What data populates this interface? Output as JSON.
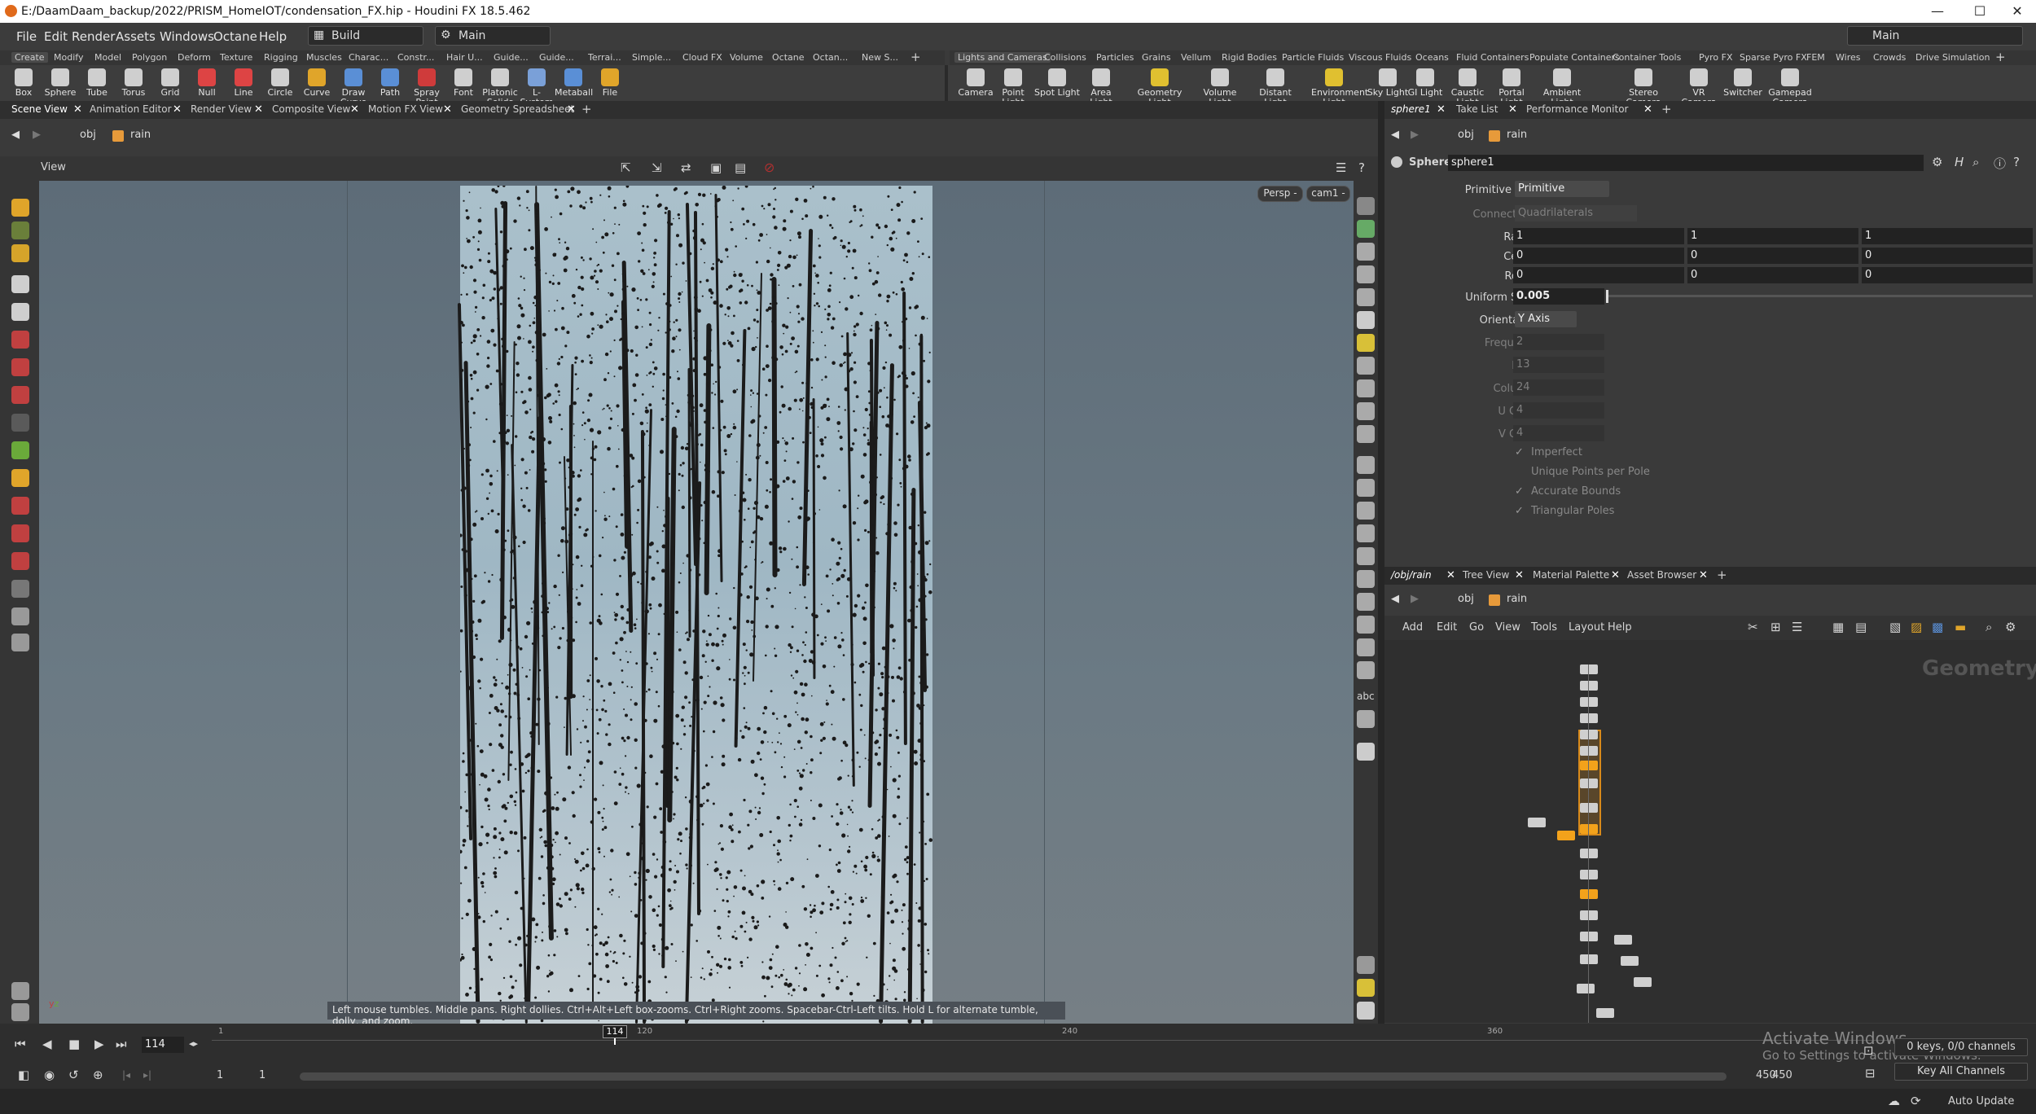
{
  "window": {
    "title": "E:/DaamDaam_backup/2022/PRISM_HomeIOT/condensation_FX.hip - Houdini FX 18.5.462",
    "min": "—",
    "max": "☐",
    "close": "✕"
  },
  "menu": {
    "items": [
      "File",
      "Edit",
      "Render",
      "Assets",
      "Windows",
      "Octane",
      "Help"
    ],
    "desktop": "Build",
    "context": "Main",
    "right_desktop": "Main"
  },
  "shelf_tabs_left": [
    "Create",
    "Modify",
    "Model",
    "Polygon",
    "Deform",
    "Texture",
    "Rigging",
    "Muscles",
    "Charac...",
    "Constr...",
    "Hair U...",
    "Guide...",
    "Guide...",
    "Terrai...",
    "Simple...",
    "Cloud FX",
    "Volume",
    "Octane",
    "Octan...",
    "New S..."
  ],
  "shelf_tabs_right": [
    "Lights and Cameras",
    "Collisions",
    "Particles",
    "Grains",
    "Vellum",
    "Rigid Bodies",
    "Particle Fluids",
    "Viscous Fluids",
    "Oceans",
    "Fluid Containers",
    "Populate Containers",
    "Container Tools",
    "Pyro FX",
    "Sparse Pyro FX",
    "FEM",
    "Wires",
    "Crowds",
    "Drive Simulation"
  ],
  "tools_left": [
    "Box",
    "Sphere",
    "Tube",
    "Torus",
    "Grid",
    "Null",
    "Line",
    "Circle",
    "Curve",
    "Draw Curve",
    "Path",
    "Spray Paint",
    "Font",
    "Platonic Solids",
    "L-System",
    "Metaball",
    "File"
  ],
  "tools_right": [
    "Camera",
    "Point Light",
    "Spot Light",
    "Area Light",
    "Geometry Light",
    "Volume Light",
    "Distant Light",
    "Environment Light",
    "Sky Light",
    "GI Light",
    "Caustic Light",
    "Portal Light",
    "Ambient Light",
    "Stereo Camera",
    "VR Camera",
    "Switcher",
    "Gamepad Camera"
  ],
  "left_pane_tabs": [
    "Scene View",
    "Animation Editor",
    "Render View",
    "Composite View",
    "Motion FX View",
    "Geometry Spreadsheet"
  ],
  "path": {
    "root": "obj",
    "node": "rain"
  },
  "viewport": {
    "label": "View",
    "persp": "Persp -",
    "cam": "cam1 -",
    "hint": "Left mouse tumbles. Middle pans. Right dollies. Ctrl+Alt+Left box-zooms. Ctrl+Right zooms. Spacebar-Ctrl-Left tilts. Hold L for alternate tumble, dolly, and zoom."
  },
  "params_tabs": [
    "sphere1",
    "Take List",
    "Performance Monitor"
  ],
  "params": {
    "node_type": "Sphere",
    "node_name": "sphere1",
    "primitive_type_label": "Primitive Type",
    "primitive_type": "Primitive",
    "connectivity_label": "Connectivity",
    "connectivity": "Quadrilaterals",
    "radius_label": "Radius",
    "radius": [
      "1",
      "1",
      "1"
    ],
    "center_label": "Center",
    "center": [
      "0",
      "0",
      "0"
    ],
    "rotate_label": "Rotate",
    "rotate": [
      "0",
      "0",
      "0"
    ],
    "uniform_scale_label": "Uniform Scale",
    "uniform_scale": "0.005",
    "orientation_label": "Orientation",
    "orientation": "Y Axis",
    "frequency_label": "Frequency",
    "frequency": "2",
    "rows_label": "Rows",
    "rows": "13",
    "columns_label": "Columns",
    "columns": "24",
    "uorder_label": "U Order",
    "uorder": "4",
    "vorder_label": "V Order",
    "vorder": "4",
    "imperfect": "Imperfect",
    "unique_points": "Unique Points per Pole",
    "accurate_bounds": "Accurate Bounds",
    "triangular_poles": "Triangular Poles"
  },
  "network_tabs": [
    "/obj/rain",
    "Tree View",
    "Material Palette",
    "Asset Browser"
  ],
  "network_menu": [
    "Add",
    "Edit",
    "Go",
    "View",
    "Tools",
    "Layout",
    "Help"
  ],
  "network_watermark": "Geometry",
  "timeline": {
    "frame": "114",
    "marker": "114",
    "ticks": [
      "1",
      "120",
      "240",
      "360"
    ],
    "range_start": "1",
    "range_start2": "1",
    "range_end": "450",
    "range_end2": "450",
    "keys": "0 keys, 0/0 channels",
    "key_all": "Key All Channels",
    "auto_update": "Auto Update",
    "activate_1": "Activate Windows",
    "activate_2": "Go to Settings to activate Windows."
  }
}
